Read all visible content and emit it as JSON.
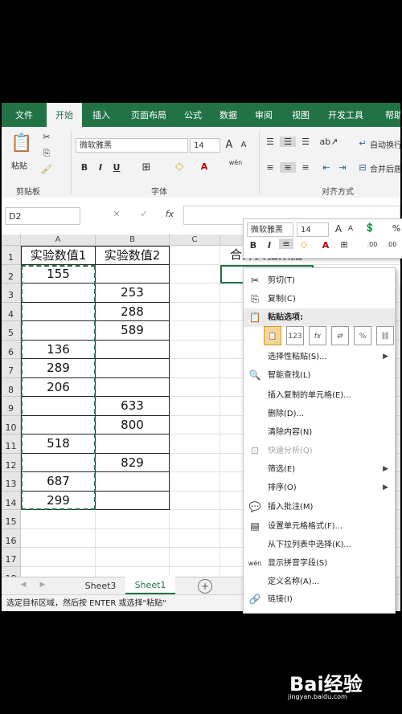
{
  "ribbon_tabs": [
    "文件",
    "开始",
    "插入",
    "页面布局",
    "公式",
    "数据",
    "审阅",
    "视图",
    "开发工具",
    "帮助"
  ],
  "ribbon": {
    "font_name": "微软雅黑",
    "font_size": "14",
    "font_grow": "A",
    "font_shrink": "A",
    "clipboard_label": "剪贴板",
    "font_label": "字体",
    "alignment_label": "对齐方式",
    "paste_label": "粘贴",
    "bold": "B",
    "italic": "I",
    "underline": "U",
    "font_color_btn": "A",
    "wrap_text": "自动换行",
    "merge_center": "合并后居中",
    "phonetic": "wén"
  },
  "formula_bar": {
    "name_box": "D2",
    "fx": "fx",
    "cancel": "✕",
    "enter": "✓"
  },
  "columns": [
    "A",
    "B",
    "C"
  ],
  "rows": [
    "1",
    "2",
    "3",
    "4",
    "5",
    "6",
    "7",
    "8",
    "9",
    "10",
    "11",
    "12",
    "13",
    "14",
    "15",
    "16",
    "17",
    "18"
  ],
  "cells": {
    "A1": "实验数值1",
    "B1": "实验数值2",
    "D1": "合并实验数据",
    "A2": "155",
    "B3": "253",
    "B4": "288",
    "B5": "589",
    "A6": "136",
    "A7": "289",
    "A8": "206",
    "B9": "633",
    "B10": "800",
    "A11": "518",
    "B12": "829",
    "A13": "687",
    "A14": "299"
  },
  "sheets": [
    "Sheet3",
    "Sheet1"
  ],
  "active_sheet": "Sheet1",
  "status_text": "选定目标区域，然后按 ENTER 或选择\"粘贴\"",
  "mini_toolbar": {
    "font": "微软雅黑",
    "size": "14",
    "percent": "%",
    "bold": "B",
    "italic": "I",
    "font_color": "A",
    "inc_dec": ".00"
  },
  "context_menu": {
    "cut": "剪切(T)",
    "copy": "复制(C)",
    "paste_options": "粘贴选项:",
    "paste_special": "选择性粘贴(S)...",
    "smart_lookup": "智能查找(L)",
    "insert_copied": "插入复制的单元格(E)...",
    "delete": "删除(D)...",
    "clear": "清除内容(N)",
    "quick_analysis": "快速分析(Q)",
    "filter": "筛选(E)",
    "sort": "排序(O)",
    "insert_comment": "插入批注(M)",
    "format_cells": "设置单元格格式(F)...",
    "pick_list": "从下拉列表中选择(K)...",
    "phonetic": "显示拼音字段(S)",
    "define_name": "定义名称(A)...",
    "link": "链接(I)"
  },
  "paste_icon_labels": [
    "123",
    "fx"
  ],
  "watermark": "Bai经验",
  "watermark_sub": "jingyan.baidu.com",
  "colors": {
    "excel_green": "#217346",
    "dashed_border": "#217346",
    "ribbon_bg": "#f3f3f3"
  }
}
